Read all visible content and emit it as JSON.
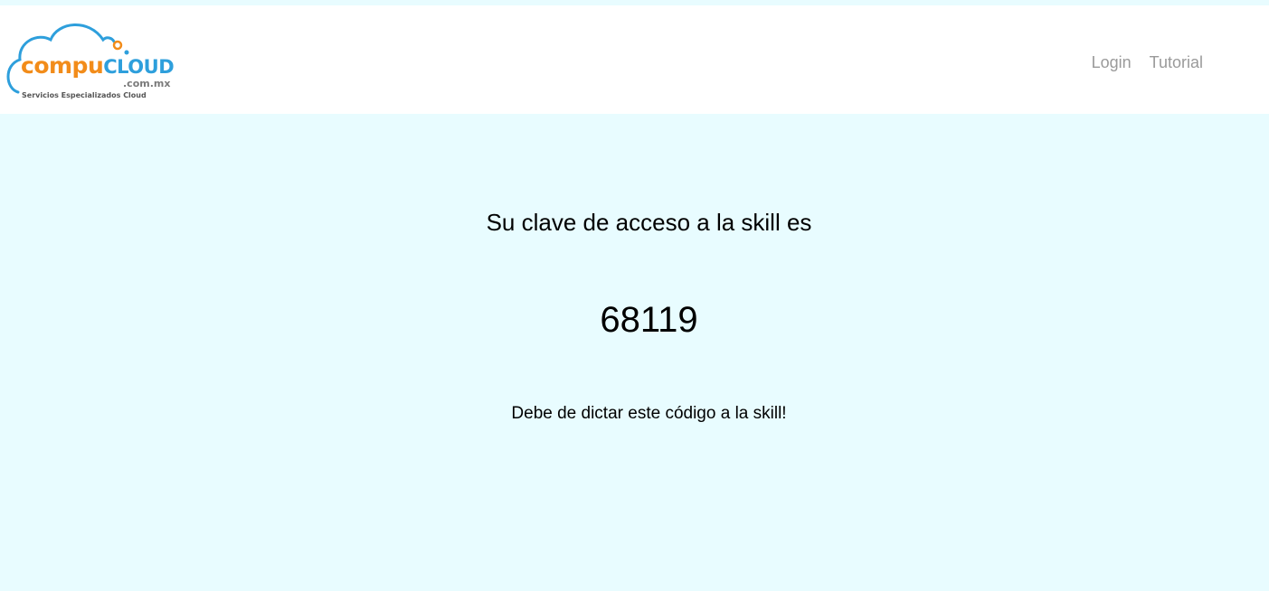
{
  "logo": {
    "brand_part1": "compu",
    "brand_part2": "CLOUD",
    "domain": ".com.mx",
    "tagline": "Servicios Especializados Cloud",
    "colors": {
      "orange": "#f28c1a",
      "blue": "#2e9fdc"
    }
  },
  "nav": {
    "links": [
      {
        "label": "Login"
      },
      {
        "label": "Tutorial"
      }
    ]
  },
  "main": {
    "heading": "Su clave de acceso a la skill es",
    "code": "68119",
    "instruction": "Debe de dictar este código a la skill!"
  },
  "colors": {
    "background": "#e8fcff",
    "navbar": "#ffffff",
    "nav_link": "#9a9a9a"
  }
}
